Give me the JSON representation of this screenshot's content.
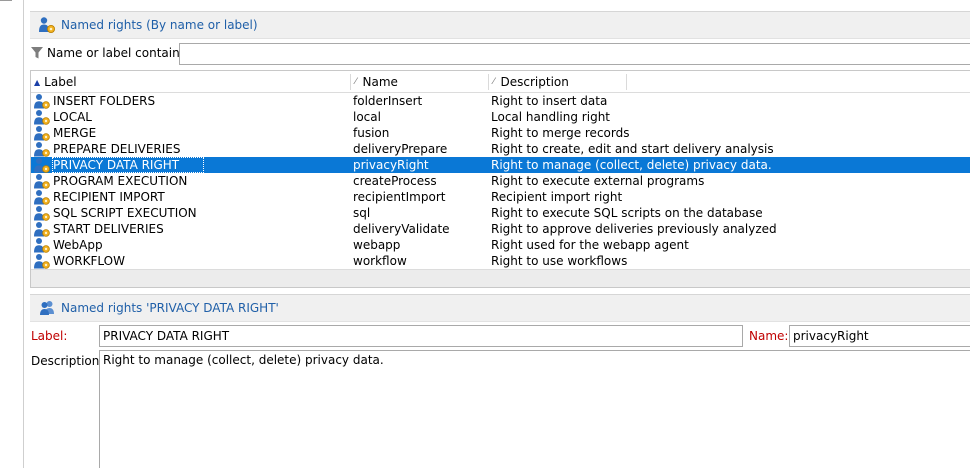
{
  "named_rights_list": {
    "title": "Named rights (By name or label)",
    "filter_label": "Name or label contains:",
    "filter_value": "",
    "columns": [
      {
        "label": "Label",
        "sort": "asc"
      },
      {
        "label": "Name",
        "sort": "none"
      },
      {
        "label": "Description",
        "sort": "none"
      }
    ],
    "rows": [
      {
        "label": "INSERT FOLDERS",
        "name": "folderInsert",
        "description": "Right to insert data",
        "selected": false
      },
      {
        "label": "LOCAL",
        "name": "local",
        "description": "Local handling right",
        "selected": false
      },
      {
        "label": "MERGE",
        "name": "fusion",
        "description": "Right to merge records",
        "selected": false
      },
      {
        "label": "PREPARE DELIVERIES",
        "name": "deliveryPrepare",
        "description": "Right to create, edit and start delivery analysis",
        "selected": false
      },
      {
        "label": "PRIVACY DATA RIGHT",
        "name": "privacyRight",
        "description": "Right to manage (collect, delete) privacy data.",
        "selected": true
      },
      {
        "label": "PROGRAM EXECUTION",
        "name": "createProcess",
        "description": "Right to execute external programs",
        "selected": false
      },
      {
        "label": "RECIPIENT IMPORT",
        "name": "recipientImport",
        "description": "Recipient import right",
        "selected": false
      },
      {
        "label": "SQL SCRIPT EXECUTION",
        "name": "sql",
        "description": "Right to execute SQL scripts on the database",
        "selected": false
      },
      {
        "label": "START DELIVERIES",
        "name": "deliveryValidate",
        "description": "Right to approve deliveries previously analyzed",
        "selected": false
      },
      {
        "label": "WebApp",
        "name": "webapp",
        "description": "Right used for the webapp agent",
        "selected": false
      },
      {
        "label": "WORKFLOW",
        "name": "workflow",
        "description": "Right to use workflows",
        "selected": false
      }
    ]
  },
  "detail": {
    "title": "Named rights 'PRIVACY DATA RIGHT'",
    "label_caption": "Label:",
    "label_value": "PRIVACY DATA RIGHT",
    "name_caption": "Name:",
    "name_value": "privacyRight",
    "description_caption": "Description:",
    "description_value": "Right to manage (collect, delete) privacy data."
  },
  "colors": {
    "selection": "#0a78d6",
    "header_text": "#1f5fa8",
    "required_label": "#c00000"
  },
  "icons": {
    "list_header": "named-right-icon",
    "filter": "funnel-icon",
    "row": "named-right-icon",
    "detail_header": "users-icon"
  }
}
